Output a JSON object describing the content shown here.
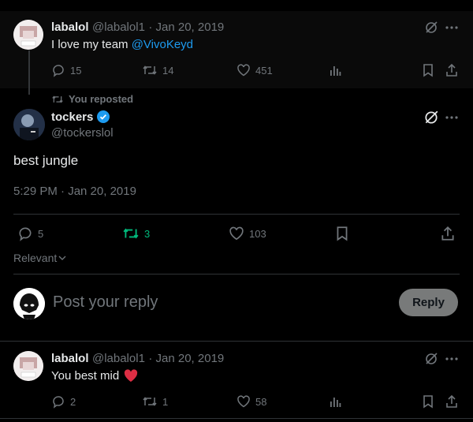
{
  "parent_tweet": {
    "name": "labalol",
    "handle": "@labalol1",
    "date": "· Jan 20, 2019",
    "text_prefix": "I love my team ",
    "mention": "@VivoKeyd",
    "replies": "15",
    "retweets": "14",
    "likes": "451"
  },
  "repost_label": "You reposted",
  "main_tweet": {
    "name": "tockers",
    "handle": "@tockerslol",
    "text": "best jungle",
    "timestamp": "5:29 PM · Jan 20, 2019",
    "replies": "5",
    "retweets": "3",
    "likes": "103",
    "retweet_active_color": "#00ba7c"
  },
  "sort": {
    "label": "Relevant"
  },
  "composer": {
    "placeholder": "Post your reply",
    "button": "Reply"
  },
  "reply_tweet": {
    "name": "labalol",
    "handle": "@labalol1",
    "date": "· Jan 20, 2019",
    "text": "You best mid",
    "emoji": "heart",
    "replies": "2",
    "retweets": "1",
    "likes": "58"
  },
  "colors": {
    "accent": "#1d9bf0",
    "verified": "#1d9bf0",
    "heart": "#f91880"
  }
}
